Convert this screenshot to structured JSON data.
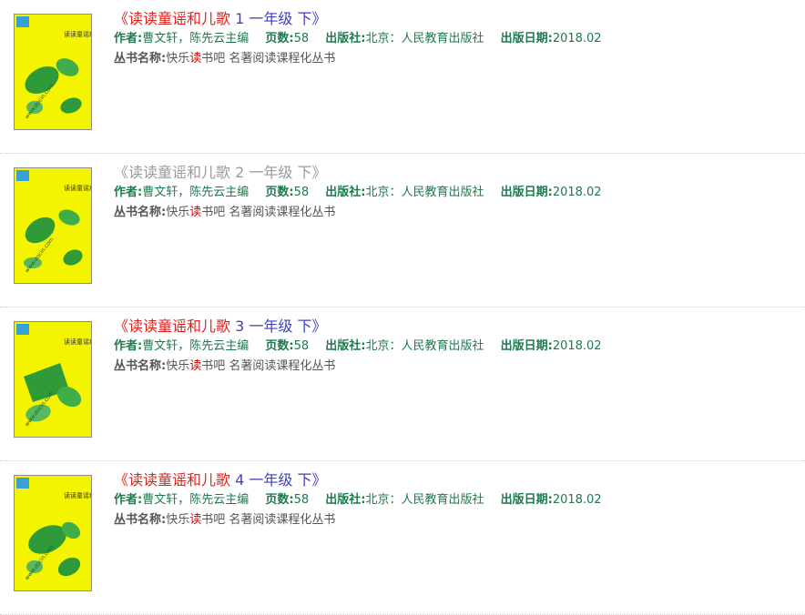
{
  "colors": {
    "title_red": "#e0201c",
    "title_blue": "#4040c0",
    "visited_gray": "#9a9a9a",
    "meta_green": "#1f7a4d",
    "series_gray": "#555555",
    "highlight_red": "#d40000",
    "cover_yellow": "#f4f300",
    "cover_green": "#2e9a3a"
  },
  "books": [
    {
      "title_open": "《",
      "title_name": "读读童谣和儿歌",
      "title_rest": " 1 一年级 下》",
      "visited": false,
      "author_label": "作者:",
      "author": "曹文轩，陈先云主编",
      "pages_label": "页数:",
      "pages": "58",
      "publisher_label": "出版社:",
      "publisher": "北京：人民教育出版社",
      "date_label": "出版日期:",
      "date": "2018.02",
      "series_label": "丛书名称:",
      "series_a": "快乐",
      "series_hl": "读",
      "series_b": "书吧 名著阅读课程化丛书",
      "cover_title": "读读童谣和儿歌",
      "cover_watermark": "www.docin.com"
    },
    {
      "title_open": "《",
      "title_name": "读读童谣和儿歌",
      "title_rest": " 2 一年级 下》",
      "visited": true,
      "author_label": "作者:",
      "author": "曹文轩，陈先云主编",
      "pages_label": "页数:",
      "pages": "58",
      "publisher_label": "出版社:",
      "publisher": "北京：人民教育出版社",
      "date_label": "出版日期:",
      "date": "2018.02",
      "series_label": "丛书名称:",
      "series_a": "快乐",
      "series_hl": "读",
      "series_b": "书吧 名著阅读课程化丛书",
      "cover_title": "读读童谣和儿歌",
      "cover_watermark": "www.docin.com"
    },
    {
      "title_open": "《",
      "title_name": "读读童谣和儿歌",
      "title_rest": " 3 一年级 下》",
      "visited": false,
      "author_label": "作者:",
      "author": "曹文轩，陈先云主编",
      "pages_label": "页数:",
      "pages": "58",
      "publisher_label": "出版社:",
      "publisher": "北京：人民教育出版社",
      "date_label": "出版日期:",
      "date": "2018.02",
      "series_label": "丛书名称:",
      "series_a": "快乐",
      "series_hl": "读",
      "series_b": "书吧 名著阅读课程化丛书",
      "cover_title": "读读童谣和儿歌",
      "cover_watermark": "www.docin.com"
    },
    {
      "title_open": "《",
      "title_name": "读读童谣和儿歌",
      "title_rest": " 4 一年级 下》",
      "visited": false,
      "author_label": "作者:",
      "author": "曹文轩，陈先云主编",
      "pages_label": "页数:",
      "pages": "58",
      "publisher_label": "出版社:",
      "publisher": "北京：人民教育出版社",
      "date_label": "出版日期:",
      "date": "2018.02",
      "series_label": "丛书名称:",
      "series_a": "快乐",
      "series_hl": "读",
      "series_b": "书吧 名著阅读课程化丛书",
      "cover_title": "读读童谣和儿歌",
      "cover_watermark": "www.docin.com"
    }
  ]
}
